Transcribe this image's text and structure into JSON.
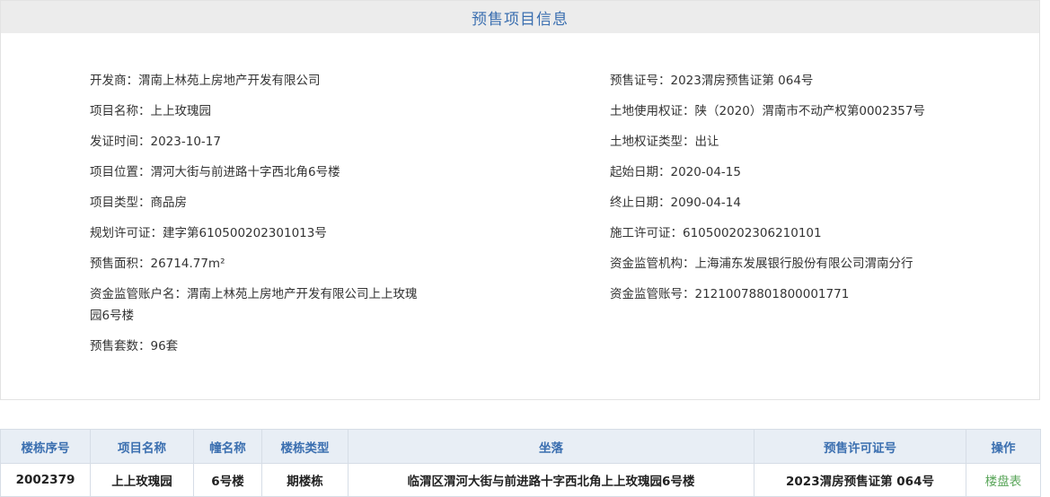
{
  "panel": {
    "title": "预售项目信息",
    "left": [
      "开发商：渭南上林苑上房地产开发有限公司",
      "项目名称：上上玫瑰园",
      "发证时间：2023-10-17",
      "项目位置：渭河大街与前进路十字西北角6号楼",
      "项目类型：商品房",
      "规划许可证：建字第610500202301013号",
      "预售面积：26714.77m²",
      "资金监管账户名：渭南上林苑上房地产开发有限公司上上玫瑰",
      "园6号楼",
      "预售套数：96套"
    ],
    "right": [
      "预售证号：2023渭房预售证第 064号",
      "土地使用权证：陕（2020）渭南市不动产权第0002357号",
      "土地权证类型：出让",
      "起始日期：2020-04-15",
      "终止日期：2090-04-14",
      "施工许可证：610500202306210101",
      "资金监管机构：上海浦东发展银行股份有限公司渭南分行",
      "资金监管账号：21210078801800001771"
    ]
  },
  "table": {
    "headers": [
      "楼栋序号",
      "项目名称",
      "幢名称",
      "楼栋类型",
      "坐落",
      "预售许可证号",
      "操作"
    ],
    "rows": [
      [
        "2002379",
        "上上玫瑰园",
        "6号楼",
        "期楼栋",
        "临渭区渭河大街与前进路十字西北角上上玫瑰园6号楼",
        "2023渭房预售证第 064号",
        "楼盘表"
      ]
    ]
  }
}
